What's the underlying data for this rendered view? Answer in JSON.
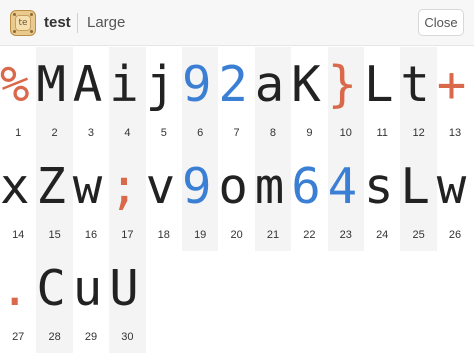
{
  "header": {
    "icon_label": "te",
    "title": "test",
    "size": "Large",
    "close_label": "Close"
  },
  "colors": {
    "accent_orange": "#d9694a",
    "accent_blue": "#3b7fd4",
    "text": "#222222"
  },
  "glyphs": [
    {
      "char": "%",
      "num": "1",
      "color": "orange"
    },
    {
      "char": "M",
      "num": "2",
      "color": "default"
    },
    {
      "char": "A",
      "num": "3",
      "color": "default"
    },
    {
      "char": "i",
      "num": "4",
      "color": "default"
    },
    {
      "char": "j",
      "num": "5",
      "color": "default"
    },
    {
      "char": "9",
      "num": "6",
      "color": "blue"
    },
    {
      "char": "2",
      "num": "7",
      "color": "blue"
    },
    {
      "char": "a",
      "num": "8",
      "color": "default"
    },
    {
      "char": "K",
      "num": "9",
      "color": "default"
    },
    {
      "char": "}",
      "num": "10",
      "color": "orange"
    },
    {
      "char": "L",
      "num": "11",
      "color": "default"
    },
    {
      "char": "t",
      "num": "12",
      "color": "default"
    },
    {
      "char": "+",
      "num": "13",
      "color": "orange"
    },
    {
      "char": "x",
      "num": "14",
      "color": "default"
    },
    {
      "char": "Z",
      "num": "15",
      "color": "default"
    },
    {
      "char": "w",
      "num": "16",
      "color": "default"
    },
    {
      "char": ";",
      "num": "17",
      "color": "orange"
    },
    {
      "char": "v",
      "num": "18",
      "color": "default"
    },
    {
      "char": "9",
      "num": "19",
      "color": "blue"
    },
    {
      "char": "o",
      "num": "20",
      "color": "default"
    },
    {
      "char": "m",
      "num": "21",
      "color": "default"
    },
    {
      "char": "6",
      "num": "22",
      "color": "blue"
    },
    {
      "char": "4",
      "num": "23",
      "color": "blue"
    },
    {
      "char": "s",
      "num": "24",
      "color": "default"
    },
    {
      "char": "L",
      "num": "25",
      "color": "default"
    },
    {
      "char": "w",
      "num": "26",
      "color": "default"
    },
    {
      "char": ".",
      "num": "27",
      "color": "orange"
    },
    {
      "char": "C",
      "num": "28",
      "color": "default"
    },
    {
      "char": "u",
      "num": "29",
      "color": "default"
    },
    {
      "char": "U",
      "num": "30",
      "color": "default"
    }
  ]
}
